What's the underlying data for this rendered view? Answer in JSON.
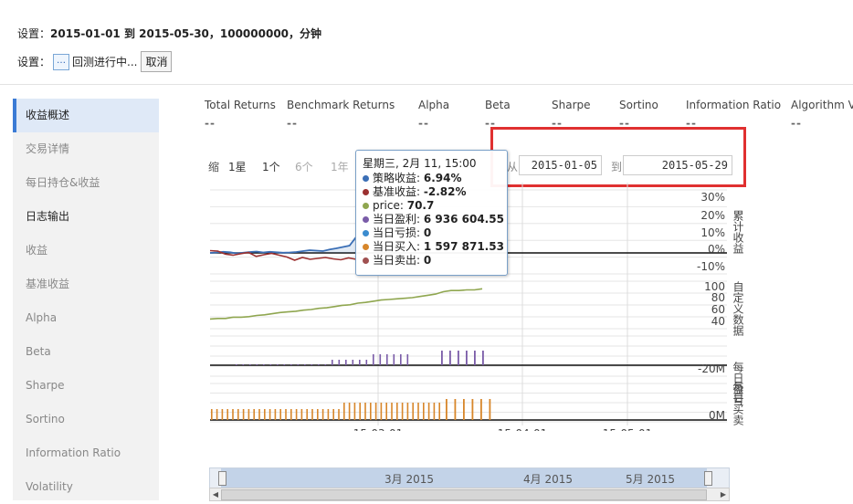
{
  "header": {
    "settings_label": "设置：",
    "settings_value": "2015-01-01 到 2015-05-30，100000000，分钟",
    "status_label": "设置：",
    "status_icon": "…",
    "status_text": "回测进行中...",
    "cancel_label": "取消"
  },
  "sidebar": {
    "items": [
      {
        "label": "收益概述"
      },
      {
        "label": "交易详情"
      },
      {
        "label": "每日持仓&收益"
      },
      {
        "label": "日志输出"
      },
      {
        "label": "收益"
      },
      {
        "label": "基准收益"
      },
      {
        "label": "Alpha"
      },
      {
        "label": "Beta"
      },
      {
        "label": "Sharpe"
      },
      {
        "label": "Sortino"
      },
      {
        "label": "Information Ratio"
      },
      {
        "label": "Volatility"
      }
    ]
  },
  "stats": [
    {
      "label": "Total Returns",
      "value": "--"
    },
    {
      "label": "Benchmark Returns",
      "value": "--"
    },
    {
      "label": "Alpha",
      "value": "--"
    },
    {
      "label": "Beta",
      "value": "--"
    },
    {
      "label": "Sharpe",
      "value": "--"
    },
    {
      "label": "Sortino",
      "value": "--"
    },
    {
      "label": "Information Ratio",
      "value": "--"
    },
    {
      "label": "Algorithm V",
      "value": "--"
    }
  ],
  "range": {
    "zoom_buttons": [
      "缩",
      "1星",
      "1个",
      "6个",
      "1年"
    ],
    "from_prefix": "从",
    "from_date": "2015-01-05",
    "to_prefix": "到",
    "to_date": "2015-05-29"
  },
  "tooltip": {
    "title": "星期三, 2月 11, 15:00",
    "rows": [
      {
        "label": "策略收益: ",
        "value": "6.94%",
        "color": "#3b6fb6"
      },
      {
        "label": "基准收益: ",
        "value": "-2.82%",
        "color": "#9b3030"
      },
      {
        "label": "price: ",
        "value": "70.7",
        "color": "#8fa64f"
      },
      {
        "label": "当日盈利: ",
        "value": "6 936 604.55",
        "color": "#7a5ca8"
      },
      {
        "label": "当日亏损: ",
        "value": "0",
        "color": "#3b8ccf"
      },
      {
        "label": "当日买入: ",
        "value": "1 597 871.53",
        "color": "#d7862a"
      },
      {
        "label": "当日卖出: ",
        "value": "0",
        "color": "#a05050"
      }
    ]
  },
  "chart_data": {
    "type": "line",
    "panels": [
      {
        "title": "累计收益",
        "ticks": [
          "30%",
          "20%",
          "10%",
          "0%",
          "-10%"
        ]
      },
      {
        "title": "自定义数据",
        "ticks": [
          "100",
          "80",
          "60",
          "40"
        ]
      },
      {
        "title": "每日盈亏",
        "ticks": [
          "-20M"
        ]
      },
      {
        "title": "每日买卖",
        "ticks": [
          "0M"
        ]
      }
    ],
    "x_ticks": [
      "15-03-01",
      "15-04-01",
      "15-05-01"
    ],
    "series": [
      {
        "name": "策略收益",
        "color": "#3b6fb6",
        "values": [
          0,
          0.2,
          0.5,
          0.3,
          -0.2,
          0.1,
          0.4,
          0.6,
          0.2,
          0.5,
          0.3,
          0.1,
          0.2,
          0.4,
          0.8,
          1.2,
          1.0,
          0.8,
          1.5,
          2.0,
          2.6,
          3.2,
          6.94
        ]
      },
      {
        "name": "基准收益",
        "color": "#9b3030",
        "values": [
          1.0,
          0.8,
          -0.5,
          -1.0,
          -0.3,
          0.2,
          -1.5,
          -0.8,
          -0.2,
          -1.0,
          -1.8,
          -3.2,
          -2.0,
          -2.8,
          -2.4,
          -2.0,
          -2.6,
          -3.0,
          -2.2,
          -2.82
        ]
      },
      {
        "name": "price",
        "color": "#8fa64f",
        "values": [
          44,
          45,
          45,
          47,
          47,
          48,
          50,
          51,
          53,
          55,
          56,
          57,
          59,
          60,
          62,
          63,
          65,
          67,
          68,
          70.7,
          72,
          74,
          76,
          77,
          78,
          79,
          80,
          82,
          84,
          86,
          90,
          92,
          92,
          93,
          93,
          95
        ]
      }
    ],
    "navigator_labels": [
      "3月 2015",
      "4月 2015",
      "5月 2015"
    ]
  }
}
